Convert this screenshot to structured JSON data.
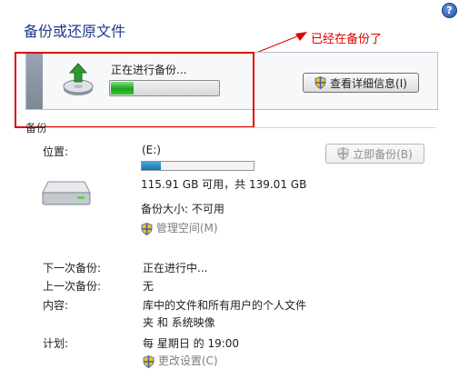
{
  "window": {
    "title": "备份或还原文件",
    "help_glyph": "?"
  },
  "annotation": {
    "text": "已经在备份了",
    "color": "#e00000"
  },
  "status": {
    "text": "正在进行备份...",
    "progress": 0.21,
    "details_button": "查看详细信息(I)"
  },
  "section": {
    "label": "备份"
  },
  "location": {
    "label": "位置:",
    "drive": "(E:)",
    "used_fraction": 0.17,
    "space": "115.91 GB 可用，共 139.01 GB",
    "backup_size": "备份大小: 不可用",
    "manage_link": "管理空间(M)",
    "backup_now_button": "立即备份(B)"
  },
  "schedule": {
    "next_label": "下一次备份:",
    "next_value": "正在进行中...",
    "last_label": "上一次备份:",
    "last_value": "无",
    "contents_label": "内容:",
    "contents_value_line1": "库中的文件和所有用户的个人文件",
    "contents_value_line2": "夹 和 系统映像",
    "schedule_label": "计划:",
    "schedule_value": "每 星期日 的 19:00",
    "change_link": "更改设置(C)"
  },
  "colors": {
    "title": "#1e3a8a",
    "progress": "#1da11d",
    "capacity": "#1474b0",
    "highlight": "#e00000"
  },
  "icons": [
    "help-icon",
    "backup-disk-icon",
    "shield-icon",
    "drive-icon"
  ]
}
